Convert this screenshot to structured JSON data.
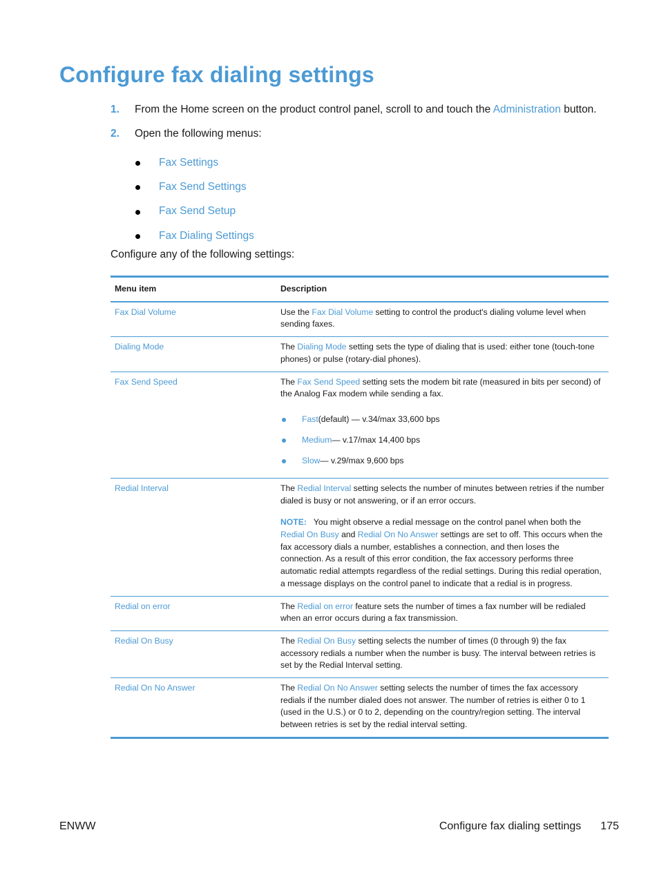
{
  "page": {
    "title": "Configure fax dialing settings",
    "steps": [
      {
        "num": "1.",
        "before": "From the Home screen on the product control panel, scroll to and touch the ",
        "link": "Administration",
        "after": " button."
      },
      {
        "num": "2.",
        "text": "Open the following menus:"
      }
    ],
    "menus": [
      "Fax Settings",
      "Fax Send Settings",
      "Fax Send Setup",
      "Fax Dialing Settings"
    ],
    "intro": "Configure any of the following settings:",
    "colors": {
      "accent": "#4b9ad4",
      "text": "#1a1a1a"
    }
  },
  "table": {
    "headers": [
      "Menu item",
      "Description"
    ],
    "rows": [
      {
        "item": "Fax Dial Volume",
        "pre": "Use the ",
        "link": "Fax Dial Volume",
        "post": " setting to control the product's dialing volume level when sending faxes."
      },
      {
        "item": "Dialing Mode",
        "pre": "The ",
        "link": "Dialing Mode",
        "post": " setting sets the type of dialing that is used: either tone (touch-tone phones) or pulse (rotary-dial phones)."
      },
      {
        "item": "Fax Send Speed",
        "pre": "The ",
        "link": "Fax Send Speed",
        "post": " setting sets the modem bit rate (measured in bits per second) of the Analog Fax modem while sending a fax.",
        "options": [
          {
            "link": "Fast",
            "text": " (default) — v.34/max 33,600 bps"
          },
          {
            "link": "Medium",
            "text": " — v.17/max 14,400 bps"
          },
          {
            "link": "Slow",
            "text": " — v.29/max 9,600 bps"
          }
        ]
      },
      {
        "item": "Redial Interval",
        "pre": "The ",
        "link": "Redial Interval",
        "post": " setting selects the number of minutes between retries if the number dialed is busy or not answering, or if an error occurs.",
        "note": {
          "label": "NOTE:",
          "pre": "You might observe a redial message on the control panel when both the ",
          "link1": "Redial On Busy",
          "mid": " and ",
          "link2": "Redial On No Answer",
          "post": " settings are set to off. This occurs when the fax accessory dials a number, establishes a connection, and then loses the connection. As a result of this error condition, the fax accessory performs three automatic redial attempts regardless of the redial settings. During this redial operation, a message displays on the control panel to indicate that a redial is in progress."
        }
      },
      {
        "item": "Redial on error",
        "pre": "The ",
        "link": "Redial on error",
        "post": " feature sets the number of times a fax number will be redialed when an error occurs during a fax transmission."
      },
      {
        "item": "Redial On Busy",
        "pre": "The ",
        "link": "Redial On Busy",
        "post": " setting selects the number of times (0 through 9) the fax accessory redials a number when the number is busy. The interval between retries is set by the Redial Interval setting."
      },
      {
        "item": "Redial On No Answer",
        "pre": "The ",
        "link": "Redial On No Answer",
        "post": " setting selects the number of times the fax accessory redials if the number dialed does not answer. The number of retries is either 0 to 1 (used in the U.S.) or 0 to 2, depending on the country/region setting. The interval between retries is set by the redial interval setting."
      }
    ]
  },
  "footer": {
    "left": "ENWW",
    "section": "Configure fax dialing settings",
    "page_number": "175"
  }
}
